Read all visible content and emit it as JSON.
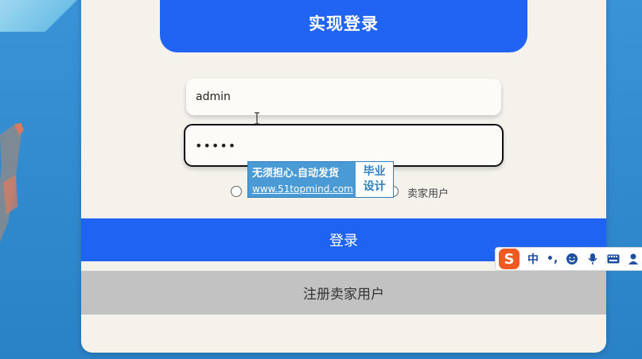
{
  "form": {
    "title": "实现登录",
    "username_value": "admin",
    "password_value": "•••••",
    "radio_options": [
      "",
      "",
      "卖家用户"
    ],
    "login_label": "登录",
    "register_label": "注册卖家用户"
  },
  "watermark": {
    "line1": "无须担心.自动发货",
    "line2": "www.51topmind.com",
    "badge_line1": "毕业",
    "badge_line2": "设计"
  },
  "ime_toolbar": {
    "logo": "S",
    "mode": "中",
    "punctuation": "•,",
    "icons": [
      "emoji-icon",
      "microphone-icon",
      "keyboard-icon",
      "user-skin-icon"
    ]
  },
  "colors": {
    "primary": "#2164f3",
    "panel": "#f5f2ec",
    "secondary_button": "#c2c2c2",
    "background": "#2f8bd0"
  }
}
